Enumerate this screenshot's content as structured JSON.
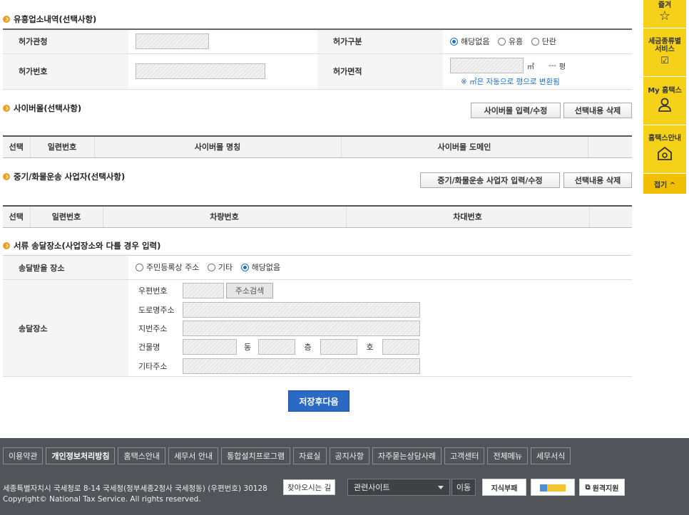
{
  "section1": {
    "title": "유흥업소내역(선택사항)",
    "permit_office_label": "허가관청",
    "permit_type_label": "허가구분",
    "permit_type_options": [
      "해당없음",
      "유흥",
      "단란"
    ],
    "permit_type_selected": "해당없음",
    "permit_number_label": "허가번호",
    "permit_area_label": "허가면적",
    "area_unit": "㎡",
    "pyeong_value": "---",
    "pyeong_unit": "평",
    "area_note": "※ ㎡은 자동으로 평으로 변환됨"
  },
  "section2": {
    "title": "사이버몰(선택사항)",
    "input_button": "사이버몰 입력/수정",
    "delete_button": "선택내용 삭제",
    "columns": [
      "선택",
      "일련번호",
      "사이버몰 명칭",
      "사이버몰 도메인",
      ""
    ]
  },
  "section3": {
    "title": "중기/화물운송 사업자(선택사항)",
    "input_button": "중기/화물운송 사업자 입력/수정",
    "delete_button": "선택내용 삭제",
    "columns": [
      "선택",
      "일련번호",
      "차량번호",
      "차대번호",
      ""
    ]
  },
  "section4": {
    "title": "서류 송달장소(사업장소와 다를 경우 입력)",
    "receive_place_label": "송달받을 장소",
    "receive_options": [
      "주민등록상 주소",
      "기타",
      "해당없음"
    ],
    "receive_selected": "해당없음",
    "delivery_place_label": "송달장소",
    "postal_code_label": "우편번호",
    "address_search_button": "주소검색",
    "road_address_label": "도로명주소",
    "lot_address_label": "지번주소",
    "building_label": "건물명",
    "dong_label": "동",
    "floor_label": "층",
    "ho_label": "호",
    "other_address_label": "기타주소"
  },
  "save_button": "저장후다음",
  "quick_menu": {
    "items": [
      "세금종류별 서비스",
      "My 홈택스",
      "홈택스안내"
    ],
    "top_label": "즐겨",
    "close_label": "접기 ^"
  },
  "footer": {
    "links": [
      "이용약관",
      "개인정보처리방침",
      "홈택스안내",
      "세무서 안내",
      "통합설치프로그램",
      "자료실",
      "공지사항",
      "자주묻는상담사례",
      "고객센터",
      "전체메뉴",
      "세무서식"
    ],
    "address": "세종특별자치시 국세청로 8-14 국세청(정부세종2청사 국세청동) (우편번호) 30128",
    "find_button": "찾아오시는 길",
    "related_sites": "관련사이트",
    "go_button": "이동",
    "copyright": "Copyright© National Tax Service. All rights reserved.",
    "banners": [
      "지식부패",
      "원격지원"
    ]
  }
}
